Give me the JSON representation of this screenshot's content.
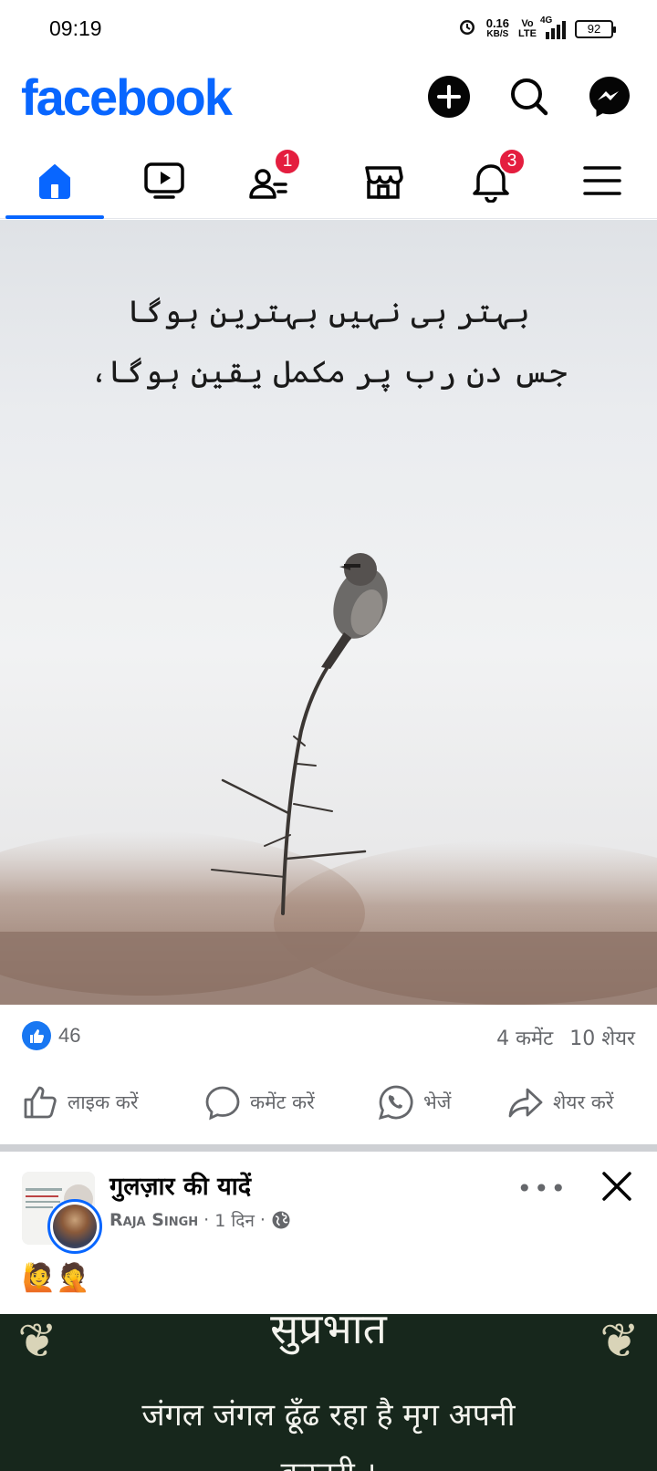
{
  "status_bar": {
    "time": "09:19",
    "net_speed": "0.16",
    "net_unit": "KB/S",
    "volte_top": "Vo",
    "volte_bottom": "LTE",
    "network": "4G",
    "battery": "92"
  },
  "header": {
    "logo": "facebook",
    "brand_color": "#0866ff",
    "icons": [
      "plus-icon",
      "search-icon",
      "messenger-icon"
    ]
  },
  "nav": {
    "tabs": [
      "home",
      "video",
      "friends",
      "marketplace",
      "notifications",
      "menu"
    ],
    "friends_badge": "1",
    "notifications_badge": "3"
  },
  "post1": {
    "image_text_line1": "بہتر ہی نہیں بہترین ہوگا",
    "image_text_line2": "جس دن رب پر مکمل یقین ہوگا،",
    "like_count": "46",
    "comments": "4 कमेंट",
    "shares": "10 शेयर",
    "actions": {
      "like": "लाइक करें",
      "comment": "कमेंट करें",
      "send": "भेजें",
      "share": "शेयर करें"
    }
  },
  "post2": {
    "group_name": "गुलज़ार की यादें",
    "author": "Raja Singh",
    "time": "1 दिन",
    "separator": "·",
    "emojis": "🙋🤦",
    "image_title": "सुप्रभात",
    "image_line1": "जंगल जंगल ढूँढ रहा है मृग अपनी",
    "image_line2": "कस्तूरी ।"
  }
}
